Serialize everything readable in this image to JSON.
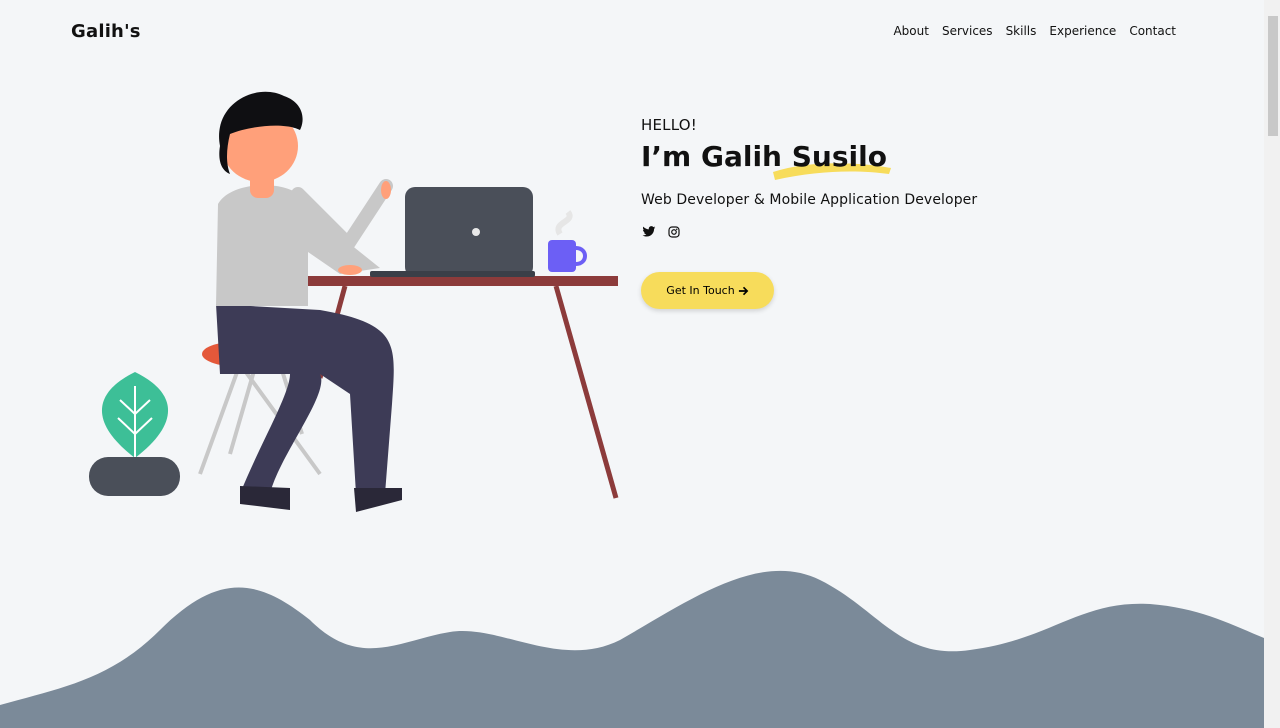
{
  "nav": {
    "brand": "Galih's",
    "links": [
      "About",
      "Services",
      "Skills",
      "Experience",
      "Contact"
    ]
  },
  "hero": {
    "greeting": "HELLO!",
    "headline_prefix": "I’m Galih ",
    "headline_highlight": "Susilo",
    "role": "Web Developer & Mobile Application Developer",
    "social_icons": [
      "twitter-icon",
      "instagram-icon"
    ],
    "cta_label": "Get In Touch",
    "cta_icon": "arrow-right-icon"
  },
  "colors": {
    "background": "#f4f6f8",
    "accent_yellow": "#f7dc5b",
    "wave": "#7b8a99",
    "desk": "#8c3b3b",
    "leaf": "#3dbf97"
  }
}
